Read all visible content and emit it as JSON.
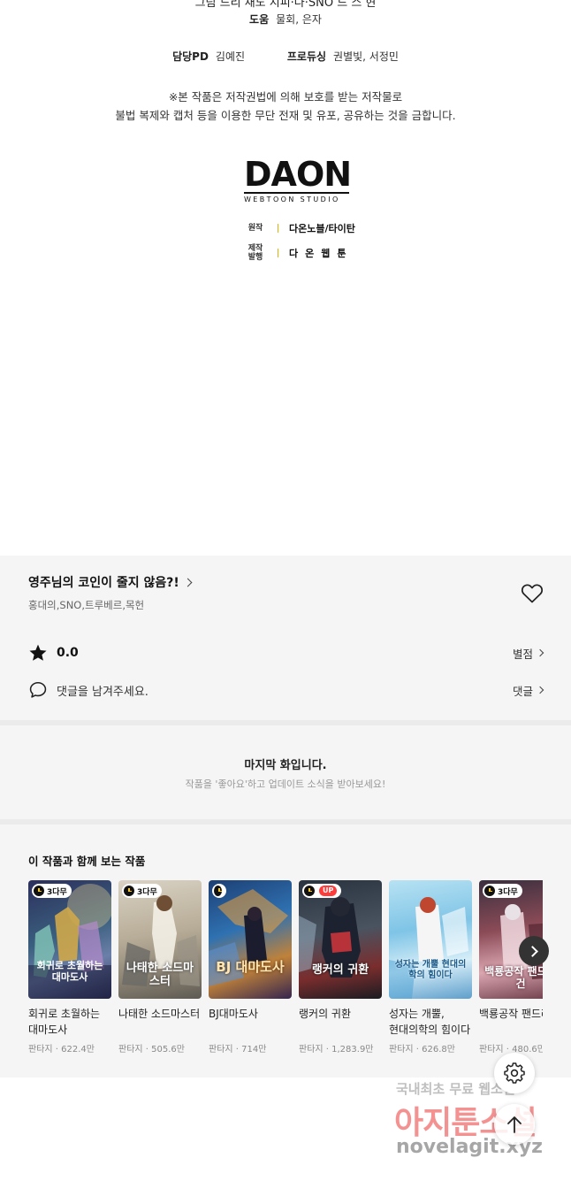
{
  "credits": {
    "cut_line": "그림 드리    채도                  지피·나·SNO         드                 스 현",
    "assist_label": "도움",
    "assist_value": "물회, 은자",
    "pd_label": "담당PD",
    "pd_value": "김예진",
    "producing_label": "프로듀싱",
    "producing_value": "권별빛, 서정민",
    "notice_line1": "※본 작품은 저작권법에 의해 보호를 받는 저작물로",
    "notice_line2": "불법 복제와 캡처 등을 이용한 무단 전재 및 유포, 공유하는 것을 금합니다.",
    "logo_main": "DAON",
    "logo_sub": "WEBTOON STUDIO",
    "original_label": "원작",
    "original_value": "다온노블/타이탄",
    "production_label_1": "제작",
    "production_label_2": "발행",
    "production_value": "다온웹툰"
  },
  "info": {
    "title": "영주님의 코인이 줄지 않음?!",
    "authors": "홍대의,SNO,트루베르,목헌",
    "rating": "0.0",
    "rating_link": "별점",
    "comment_prompt": "댓글을 남겨주세요.",
    "comment_link": "댓글"
  },
  "last_episode": {
    "title": "마지막 화입니다.",
    "subtitle": "작품을 '좋아요'하고 업데이트 소식을 받아보세요!"
  },
  "recommendations": {
    "heading": "이 작품과 함께 보는 작품",
    "items": [
      {
        "title": "회귀로 초월하는 대마도사",
        "meta": "판타지 · 622.4만",
        "badge": "3다무",
        "art_text": "회귀로 초월하는 대마도사"
      },
      {
        "title": "나태한 소드마스터",
        "meta": "판타지 · 505.6만",
        "badge": "3다무",
        "art_text": "나태한 소드마스터"
      },
      {
        "title": "BJ대마도사",
        "meta": "판타지 · 714만",
        "badge": "",
        "art_text": "BJ 대마도사"
      },
      {
        "title": "랭커의 귀환",
        "meta": "판타지 · 1,283.9만",
        "badge": "UP",
        "art_text": "랭커의 귀환"
      },
      {
        "title": "성자는 개뿔, 현대의학의 힘이다",
        "meta": "판타지 · 626.8만",
        "badge": "",
        "art_text": "성자는 개뿔 현대의학의 힘이다"
      },
      {
        "title": "백룡공작 팬드래건",
        "meta": "판타지 · 480.6만",
        "badge": "3다무",
        "art_text": "백룡공작 팬드래건"
      }
    ]
  },
  "watermark": {
    "line1": "국내최초 무료 웹소설",
    "line2": "아지툰소설",
    "line3": "novelagit.xyz"
  },
  "colors": {
    "background": "#ffffff",
    "section_bg": "#f5f5f5",
    "accent_up": "#ff3c3c",
    "separator_gold": "#e0b300"
  },
  "icons": {
    "title_chevron": "chevron-right-icon",
    "like": "heart-outline-icon",
    "rating": "star-icon",
    "comment": "speech-bubble-icon",
    "next": "chevron-right-icon",
    "settings": "gear-icon",
    "top": "arrow-up-icon",
    "badge": "clock-icon"
  }
}
